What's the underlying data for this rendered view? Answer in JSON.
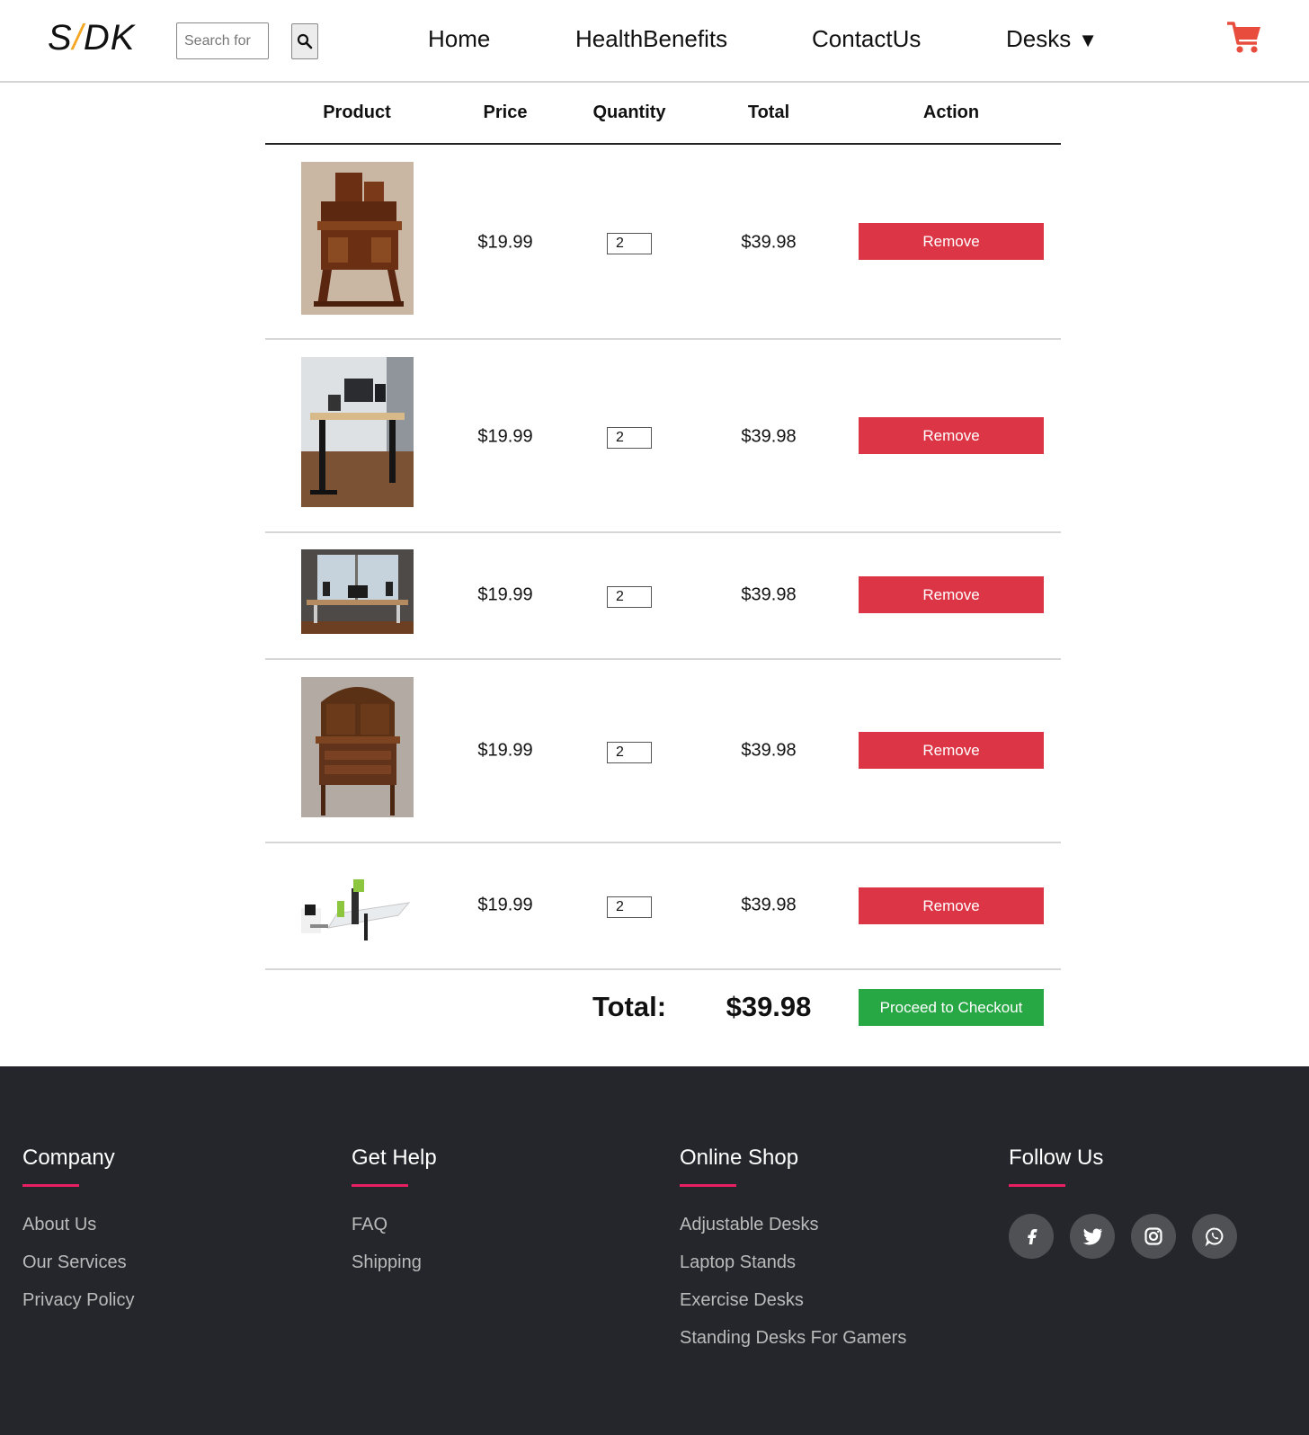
{
  "header": {
    "logo_left": "S",
    "logo_slash": "/",
    "logo_right": "DK",
    "search_placeholder": "Search for",
    "nav": [
      {
        "label": "Home"
      },
      {
        "label": "HealthBenefits"
      },
      {
        "label": "ContactUs"
      },
      {
        "label": "Desks",
        "caret": "▼"
      }
    ],
    "cart_icon": "shopping-cart-icon",
    "accent_color": "#e74c3c"
  },
  "cart": {
    "columns": [
      "Product",
      "Price",
      "Quantity",
      "Total",
      "Action"
    ],
    "rows": [
      {
        "image": "antique-writing-desk",
        "price": "$19.99",
        "quantity": "2",
        "total": "$39.98",
        "action": "Remove"
      },
      {
        "image": "standing-desk-office",
        "price": "$19.99",
        "quantity": "2",
        "total": "$39.98",
        "action": "Remove"
      },
      {
        "image": "desk-by-window",
        "price": "$19.99",
        "quantity": "2",
        "total": "$39.98",
        "action": "Remove"
      },
      {
        "image": "antique-secretary-desk",
        "price": "$19.99",
        "quantity": "2",
        "total": "$39.98",
        "action": "Remove"
      },
      {
        "image": "modern-office-desks",
        "price": "$19.99",
        "quantity": "2",
        "total": "$39.98",
        "action": "Remove"
      }
    ],
    "total_label": "Total:",
    "total_value": "$39.98",
    "checkout_label": "Proceed to Checkout",
    "remove_color": "#dc3545",
    "checkout_color": "#28a745"
  },
  "footer": {
    "columns": [
      {
        "title": "Company",
        "links": [
          "About Us",
          "Our Services",
          "Privacy Policy"
        ]
      },
      {
        "title": "Get Help",
        "links": [
          "FAQ",
          "Shipping"
        ]
      },
      {
        "title": "Online Shop",
        "links": [
          "Adjustable Desks",
          "Laptop Stands",
          "Exercise Desks",
          "Standing Desks For Gamers"
        ]
      },
      {
        "title": "Follow Us",
        "links": []
      }
    ],
    "socials": [
      "facebook-icon",
      "twitter-icon",
      "instagram-icon",
      "whatsapp-icon"
    ],
    "background": "#24262b",
    "accent": "#e91e63"
  }
}
